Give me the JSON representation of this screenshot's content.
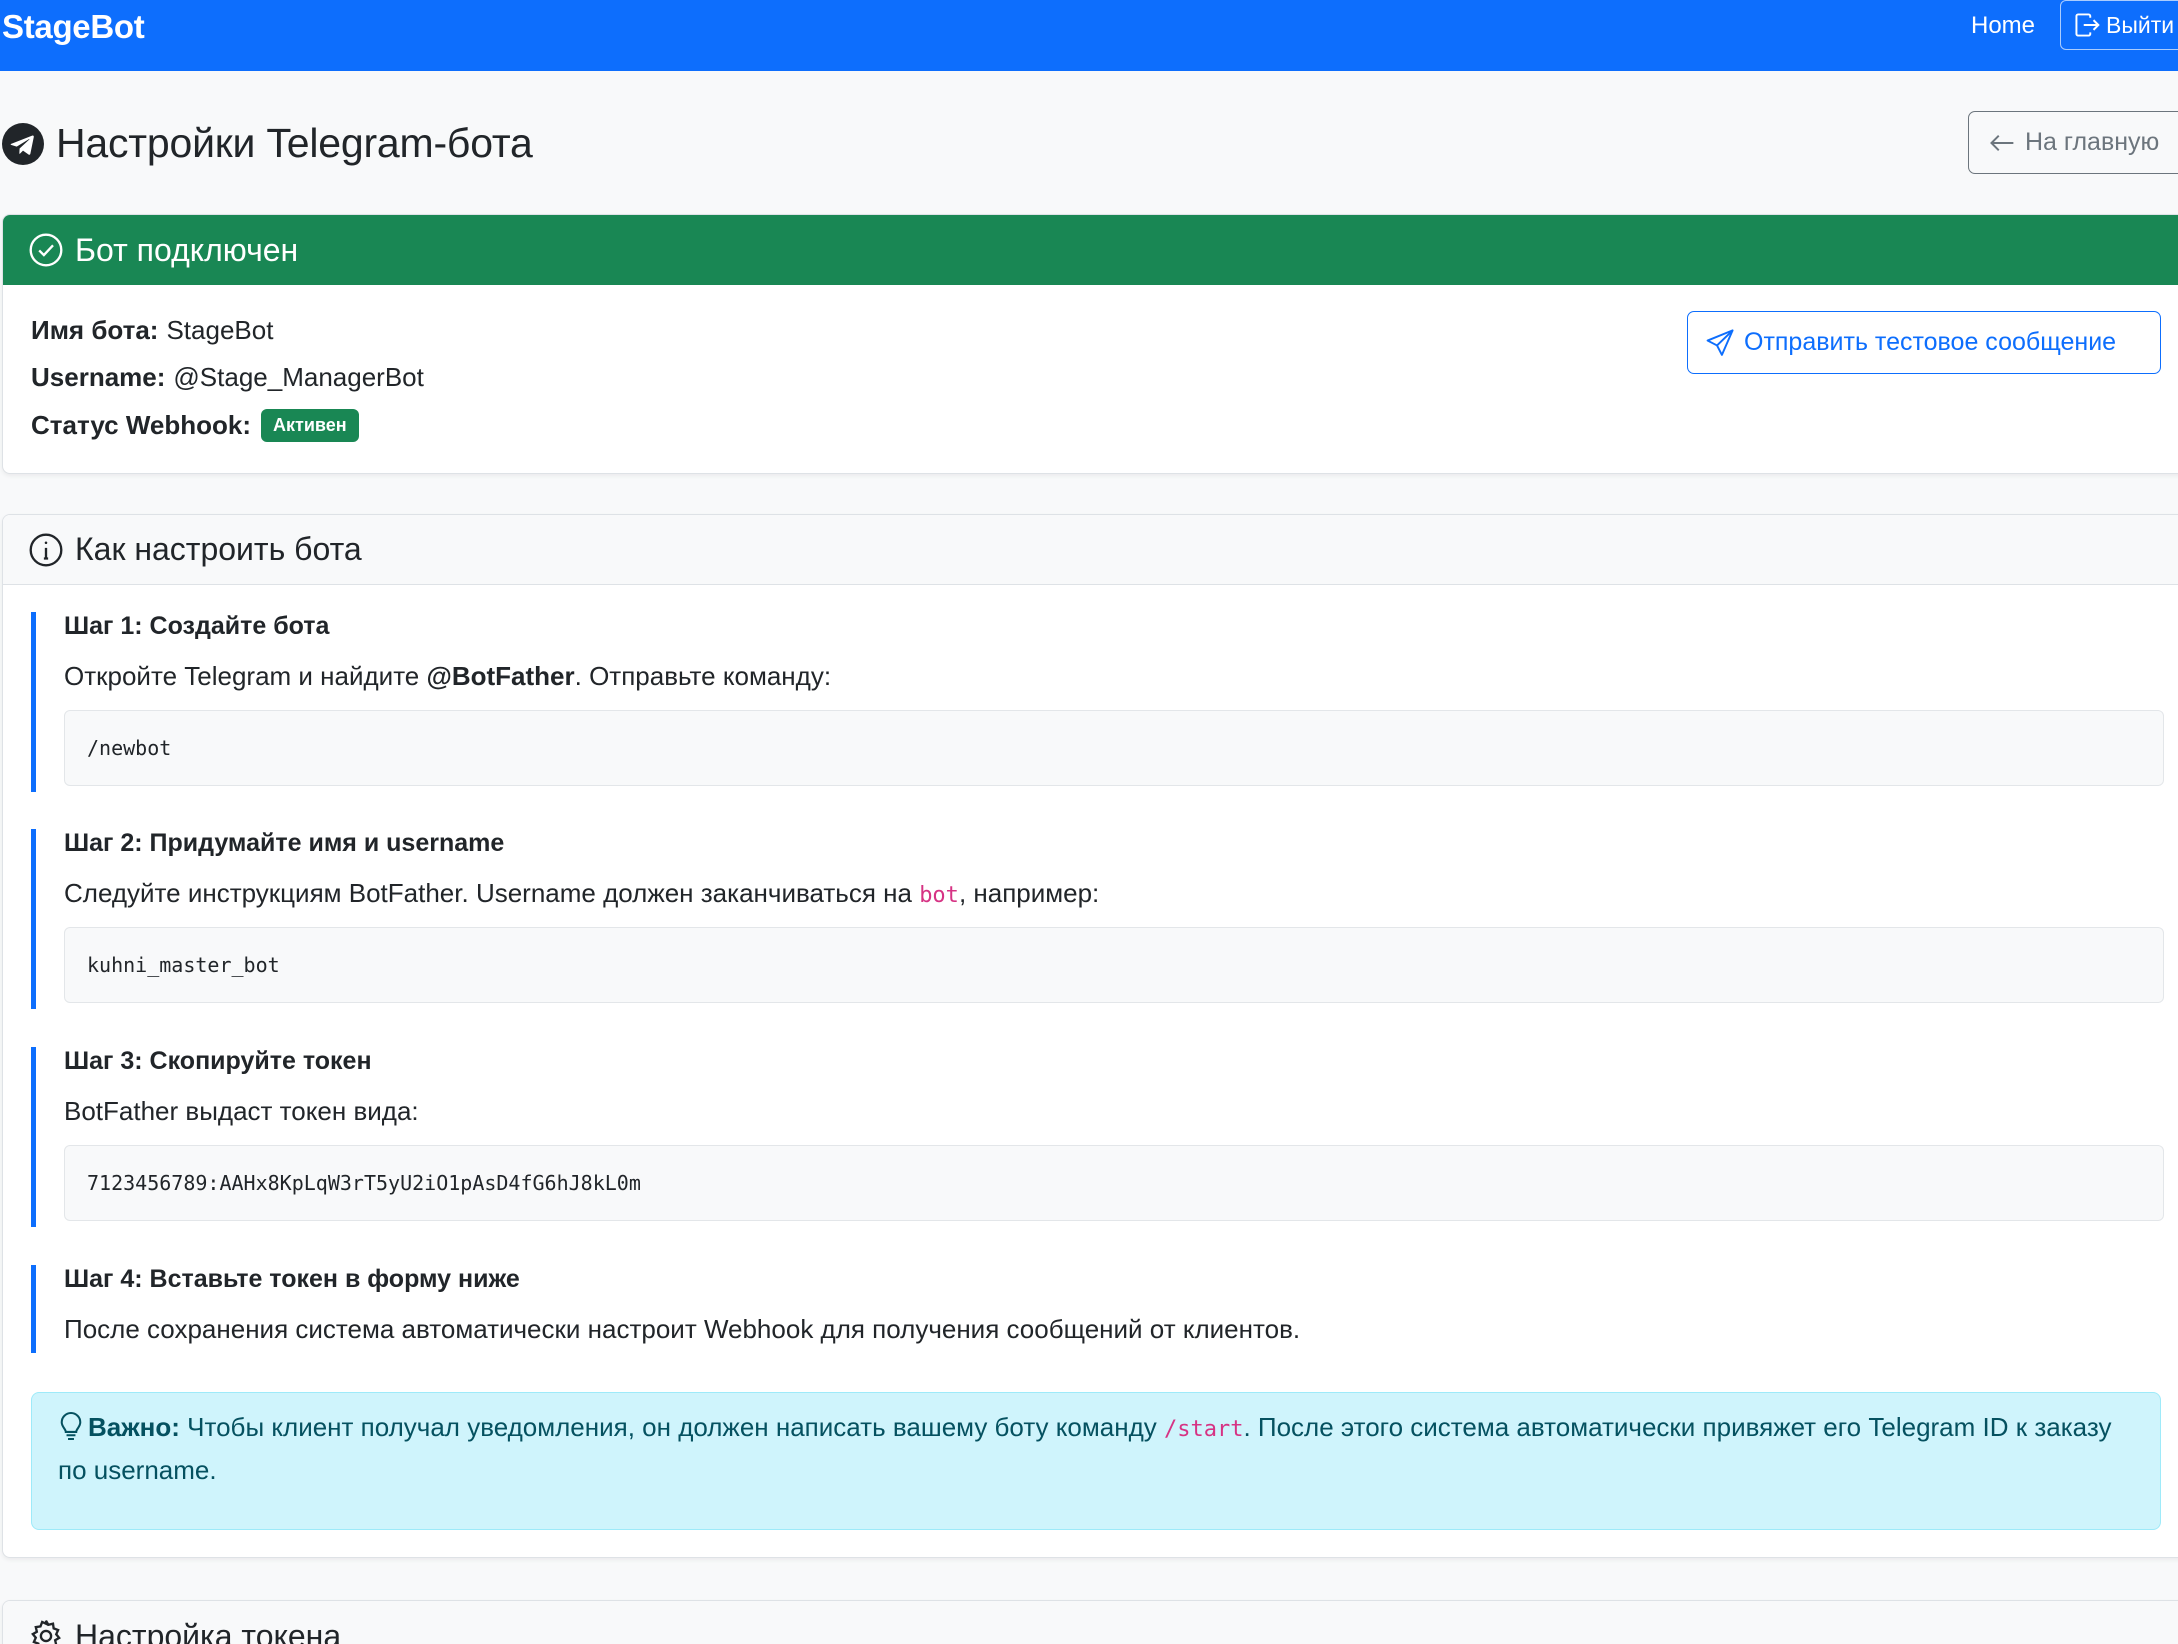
{
  "navbar": {
    "brand": "StageBot",
    "home": "Home",
    "logout": "Выйти"
  },
  "page": {
    "title": "Настройки Telegram-бота",
    "back_button": "На главную"
  },
  "status_card": {
    "header": "Бот подключен",
    "bot_name_label": "Имя бота:",
    "bot_name_value": "StageBot",
    "username_label": "Username:",
    "username_value": "@Stage_ManagerBot",
    "webhook_label": "Статус Webhook:",
    "webhook_badge": "Активен",
    "test_button": "Отправить тестовое сообщение"
  },
  "howto_card": {
    "header": "Как настроить бота",
    "steps": [
      {
        "title": "Шаг 1: Создайте бота",
        "text_before": "Откройте Telegram и найдите ",
        "text_bold": "@BotFather",
        "text_after": ". Отправьте команду:",
        "code": "/newbot"
      },
      {
        "title": "Шаг 2: Придумайте имя и username",
        "text_before": "Следуйте инструкциям BotFather. Username должен заканчиваться на ",
        "text_code": "bot",
        "text_after": ", например:",
        "code": "kuhni_master_bot"
      },
      {
        "title": "Шаг 3: Скопируйте токен",
        "text": "BotFather выдаст токен вида:",
        "code": "7123456789:AAHx8KpLqW3rT5yU2iO1pAsD4fG6hJ8kL0m"
      },
      {
        "title": "Шаг 4: Вставьте токен в форму ниже",
        "text": "После сохранения система автоматически настроит Webhook для получения сообщений от клиентов."
      }
    ],
    "alert": {
      "label": "Важно:",
      "text_before": " Чтобы клиент получал уведомления, он должен написать вашему боту команду ",
      "code": "/start",
      "text_after": ". После этого система автоматически привяжет его Telegram ID к заказу по username."
    }
  },
  "token_card": {
    "header": "Настройка токена"
  },
  "colors": {
    "primary": "#0d6efd",
    "success": "#198754",
    "info_bg": "#cff4fc",
    "info_text": "#055160",
    "code_inline": "#d63384"
  },
  "icons": [
    "telegram-icon",
    "logout-icon",
    "arrow-left-icon",
    "check-circle-icon",
    "send-icon",
    "info-circle-icon",
    "lightbulb-icon",
    "gear-icon"
  ]
}
